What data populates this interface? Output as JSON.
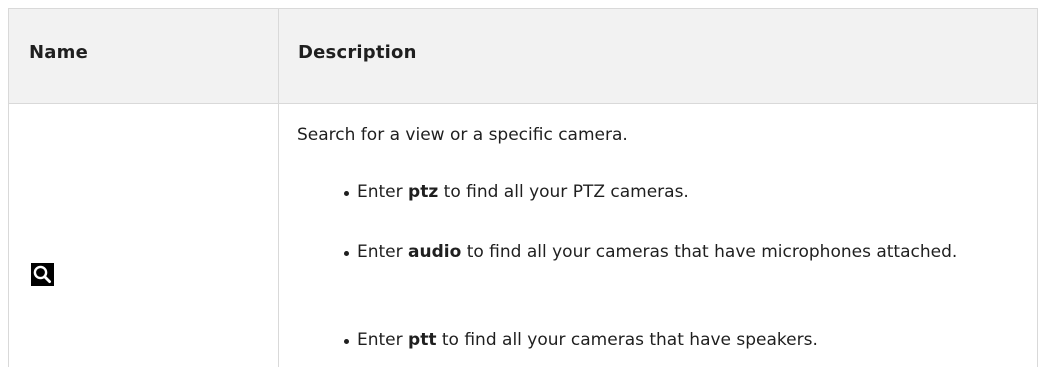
{
  "table": {
    "headers": {
      "name": "Name",
      "description": "Description"
    },
    "row": {
      "icon": "search-icon",
      "intro": "Search for a view or a specific camera.",
      "bullets": [
        {
          "prefix": "Enter ",
          "keyword": "ptz",
          "suffix": " to find all your PTZ cameras."
        },
        {
          "prefix": "Enter ",
          "keyword": "audio",
          "suffix": " to find all your cameras that have microphones attached."
        },
        {
          "prefix": "Enter ",
          "keyword": "ptt",
          "suffix": " to find all your cameras that have speakers."
        }
      ]
    }
  },
  "colors": {
    "header_bg": "#f2f2f2",
    "border": "#d9d9d9",
    "text": "#1f1f1f",
    "icon_bg": "#000000"
  }
}
